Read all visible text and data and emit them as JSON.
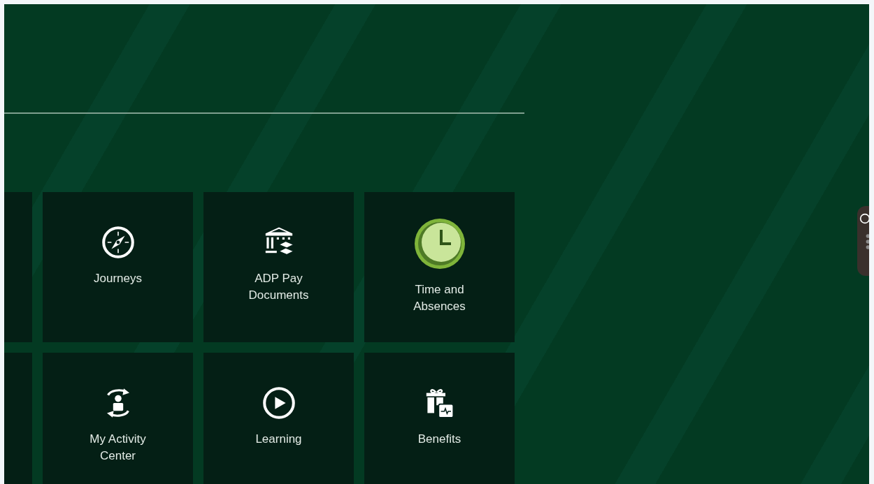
{
  "tiles": [
    {
      "label": "Journeys",
      "kind": "compass"
    },
    {
      "label": "ADP Pay Documents",
      "kind": "bank"
    },
    {
      "label": "Time and Absences",
      "kind": "clock"
    },
    {
      "label": "My Activity Center",
      "kind": "activity"
    },
    {
      "label": "Learning",
      "kind": "play"
    },
    {
      "label": "Benefits",
      "kind": "gift"
    }
  ]
}
